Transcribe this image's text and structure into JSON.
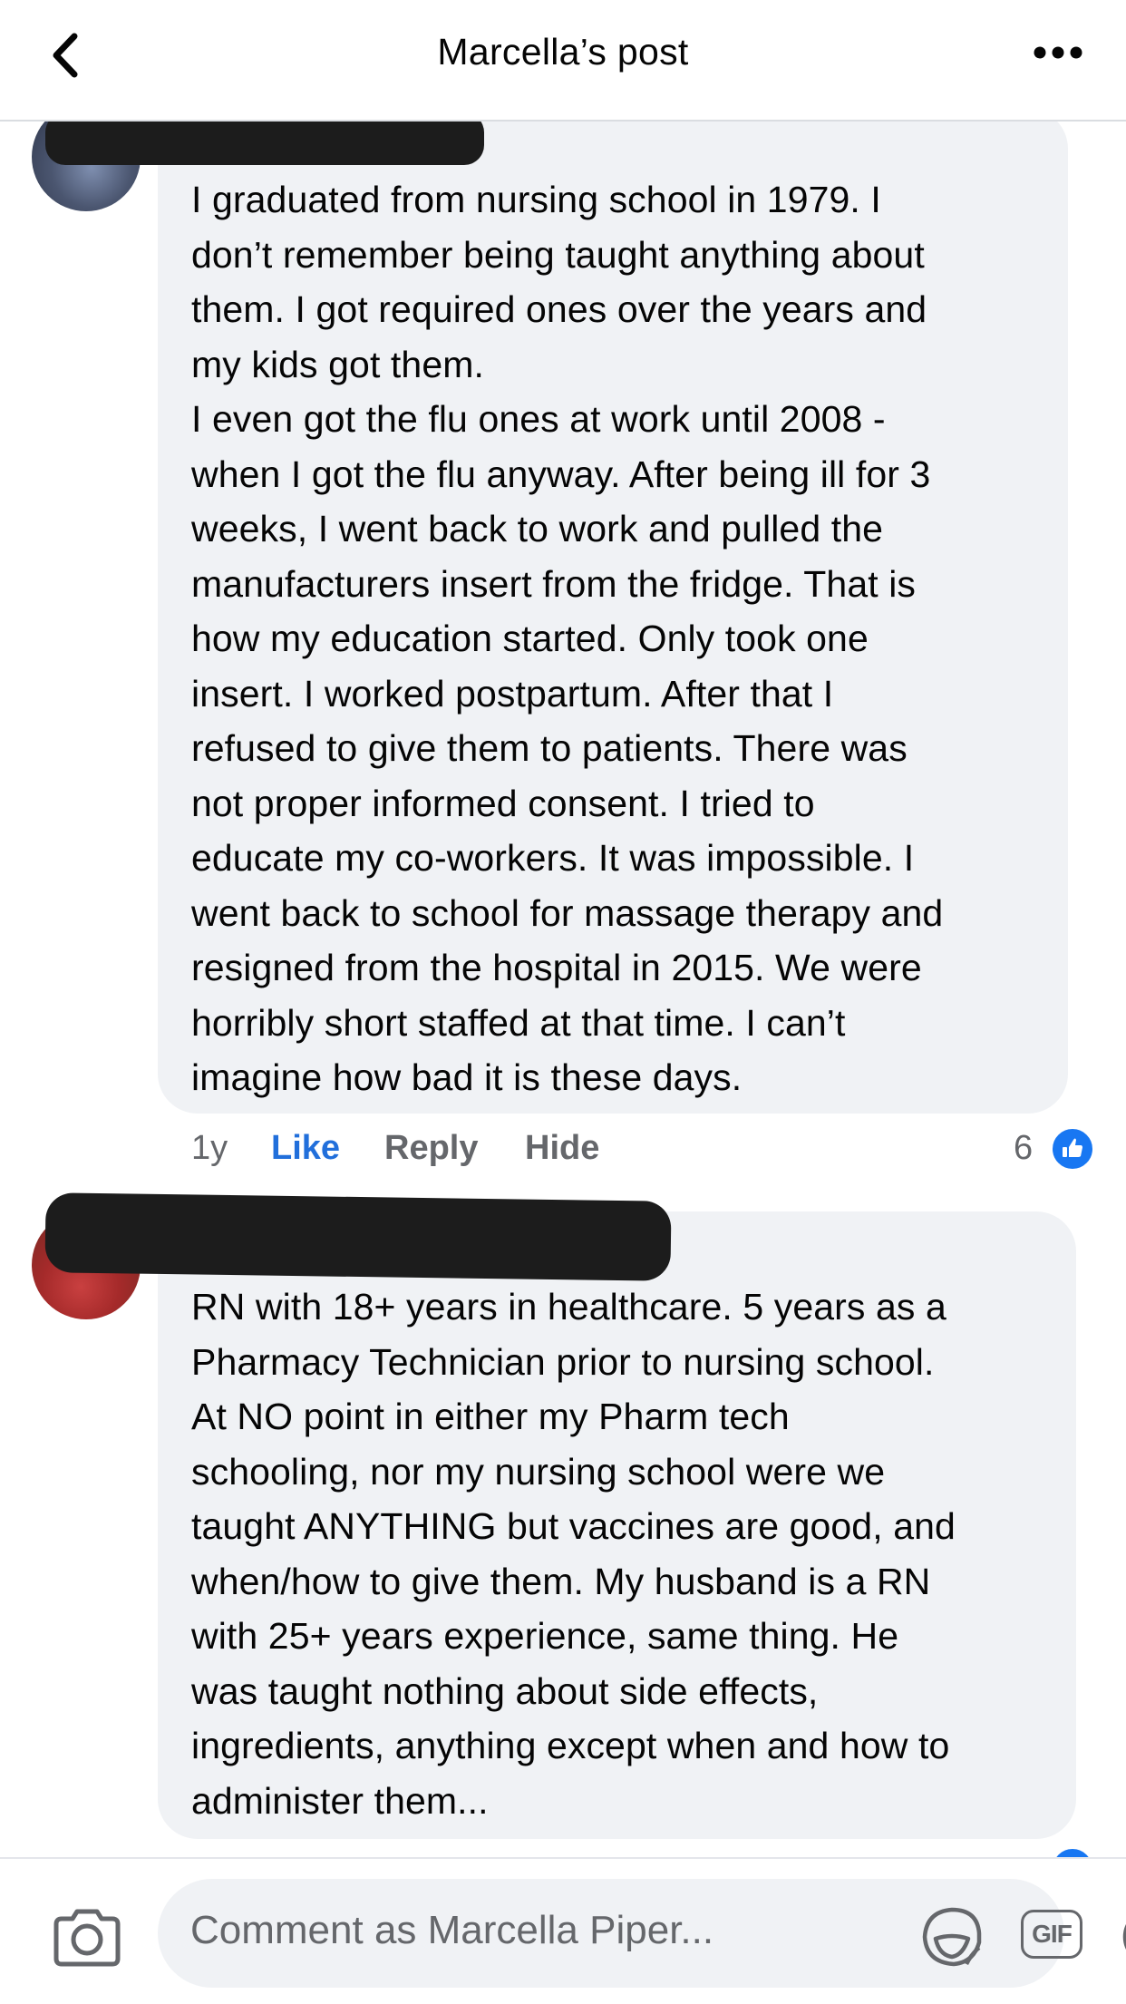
{
  "header": {
    "title": "Marcella’s post",
    "back_icon": "chevron-left-icon",
    "more_icon": "more-horizontal-icon"
  },
  "comments": [
    {
      "author_redacted": true,
      "text": "I graduated from nursing school in 1979. I\ndon’t remember being taught anything about\nthem. I got required ones over the years and\nmy kids got them.\nI even got the flu ones at work until 2008 -\nwhen I got the flu anyway. After being ill for 3\nweeks, I went back to work and pulled the\nmanufacturers insert from the fridge. That is\nhow my education started. Only took one\ninsert. I worked postpartum. After that I\nrefused to give them to patients. There was\nnot proper informed consent. I tried  to\neducate my co-workers. It was impossible. I\nwent back to school for massage therapy and\nresigned from the hospital in 2015. We were\nhorribly short staffed at that time. I can’t\nimagine how bad it is these days.",
      "time": "1y",
      "actions": {
        "like": "Like",
        "reply": "Reply",
        "hide": "Hide"
      },
      "reaction_count": "6",
      "reaction_icon": "thumbs-up-icon"
    },
    {
      "author_redacted": true,
      "text": "RN with 18+ years in healthcare. 5 years as a\nPharmacy Technician prior to nursing school.\nAt NO point in either my Pharm tech\nschooling, nor my nursing school were we\ntaught ANYTHING but vaccines are good, and\nwhen/how to give them. My husband is a RN\nwith 25+ years experience, same thing. He\nwas taught nothing about side effects,\ningredients, anything except when and how to\nadminister them..."
    }
  ],
  "composer": {
    "placeholder": "Comment as Marcella Piper...",
    "camera_icon": "camera-icon",
    "sticker_icon": "sticker-icon",
    "gif_label": "GIF",
    "emoji_icon": "emoji-icon"
  },
  "colors": {
    "accent": "#1877f2",
    "bubble": "#f0f2f5",
    "secondary_text": "#65676b"
  }
}
